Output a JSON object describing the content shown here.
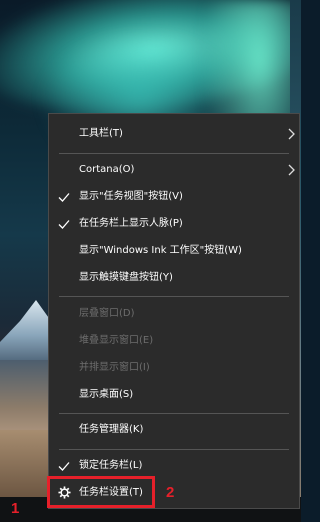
{
  "menu": {
    "items": [
      {
        "label": "工具栏(T)",
        "enabled": true,
        "checked": false,
        "submenu": true
      },
      {
        "label": "Cortana(O)",
        "enabled": true,
        "checked": false,
        "submenu": true
      },
      {
        "label": "显示\"任务视图\"按钮(V)",
        "enabled": true,
        "checked": true,
        "submenu": false
      },
      {
        "label": "在任务栏上显示人脉(P)",
        "enabled": true,
        "checked": true,
        "submenu": false
      },
      {
        "label": "显示\"Windows Ink 工作区\"按钮(W)",
        "enabled": true,
        "checked": false,
        "submenu": false
      },
      {
        "label": "显示触摸键盘按钮(Y)",
        "enabled": true,
        "checked": false,
        "submenu": false
      },
      {
        "label": "层叠窗口(D)",
        "enabled": false,
        "checked": false,
        "submenu": false
      },
      {
        "label": "堆叠显示窗口(E)",
        "enabled": false,
        "checked": false,
        "submenu": false
      },
      {
        "label": "并排显示窗口(I)",
        "enabled": false,
        "checked": false,
        "submenu": false
      },
      {
        "label": "显示桌面(S)",
        "enabled": true,
        "checked": false,
        "submenu": false
      },
      {
        "label": "任务管理器(K)",
        "enabled": true,
        "checked": false,
        "submenu": false
      },
      {
        "label": "锁定任务栏(L)",
        "enabled": true,
        "checked": true,
        "submenu": false
      },
      {
        "label": "任务栏设置(T)",
        "enabled": true,
        "checked": false,
        "submenu": false,
        "icon": "gear-icon"
      }
    ]
  },
  "annotations": {
    "step1": "1",
    "step2": "2",
    "color": "#e6202a"
  }
}
